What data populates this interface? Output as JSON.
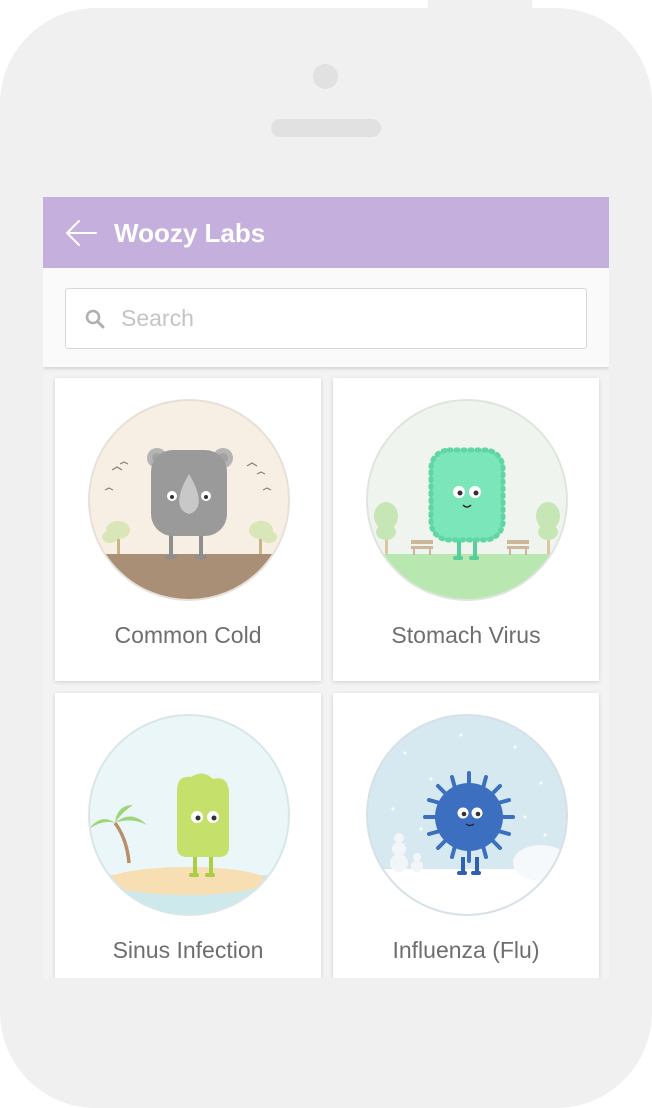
{
  "app": {
    "title": "Woozy Labs"
  },
  "icons": {
    "back": "arrow-left-icon",
    "search": "search-icon"
  },
  "colors": {
    "appbar": "#c5afdc",
    "card_label": "#6e6e6e"
  },
  "search": {
    "placeholder": "Search",
    "value": ""
  },
  "conditions": [
    {
      "label": "Common Cold"
    },
    {
      "label": "Stomach Virus"
    },
    {
      "label": "Sinus Infection"
    },
    {
      "label": "Influenza (Flu)"
    }
  ]
}
